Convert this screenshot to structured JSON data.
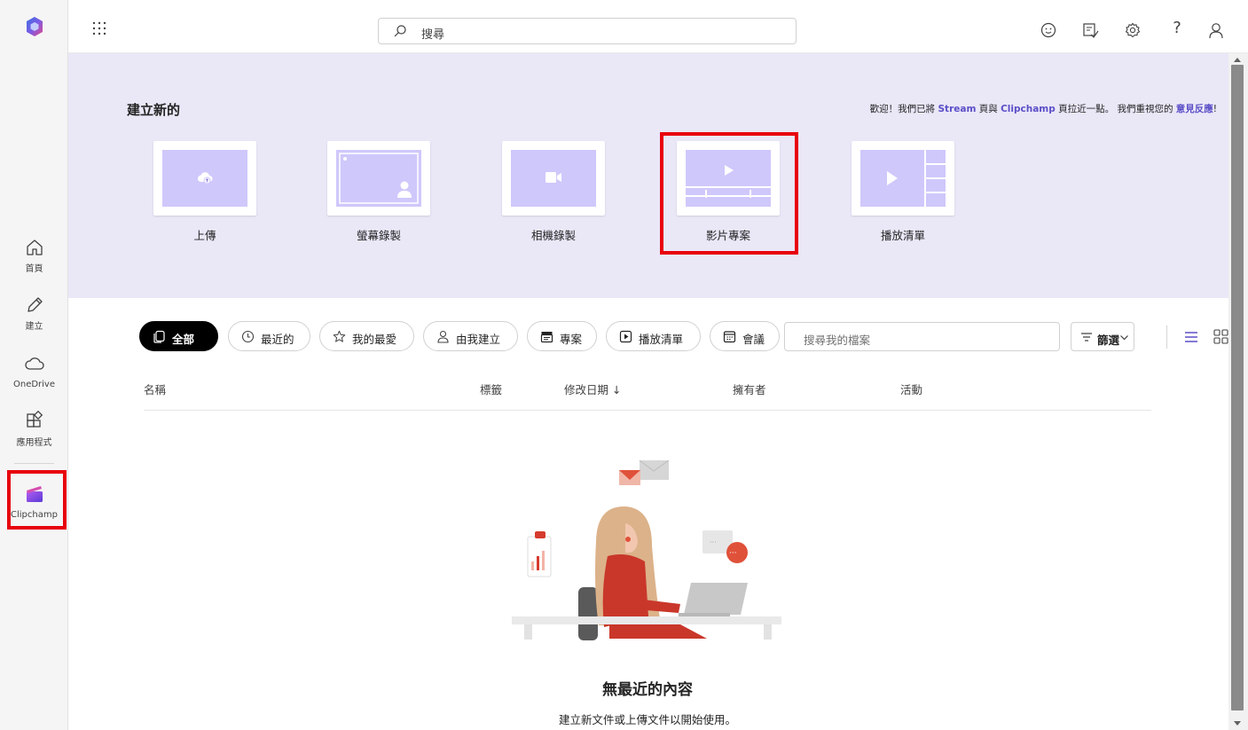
{
  "rail": {
    "items": [
      {
        "label": "首頁",
        "icon": "home-icon"
      },
      {
        "label": "建立",
        "icon": "pen-icon"
      },
      {
        "label": "OneDrive",
        "icon": "cloud-icon"
      },
      {
        "label": "應用程式",
        "icon": "apps-icon"
      },
      {
        "label": "Clipchamp",
        "icon": "clipchamp-icon"
      }
    ]
  },
  "topbar": {
    "search_placeholder": "搜尋",
    "icons": [
      "smiley-icon",
      "feedback-icon",
      "settings-icon",
      "help-icon",
      "account-icon"
    ],
    "help_glyph": "?"
  },
  "create": {
    "title": "建立新的",
    "message_pre": "歡迎！我們已將 ",
    "message_link1": "Stream",
    "message_mid1": " 頁與 ",
    "message_link2": "Clipchamp",
    "message_mid2": " 頁拉近一點。 我們重視您的 ",
    "message_link3": "意見反應",
    "message_end": "!",
    "tiles": [
      {
        "label": "上傳",
        "icon": "upload-cloud-icon"
      },
      {
        "label": "螢幕錄製",
        "icon": "screen-record-icon"
      },
      {
        "label": "相機錄製",
        "icon": "camera-icon"
      },
      {
        "label": "影片專案",
        "icon": "video-project-icon"
      },
      {
        "label": "播放清單",
        "icon": "playlist-icon"
      }
    ]
  },
  "filters": {
    "pills": [
      {
        "label": "全部",
        "icon": "all-icon",
        "active": true
      },
      {
        "label": "最近的",
        "icon": "clock-icon",
        "active": false
      },
      {
        "label": "我的最愛",
        "icon": "star-icon",
        "active": false
      },
      {
        "label": "由我建立",
        "icon": "person-icon",
        "active": false
      },
      {
        "label": "專案",
        "icon": "clapper-icon",
        "active": false
      },
      {
        "label": "播放清單",
        "icon": "play-square-icon",
        "active": false
      },
      {
        "label": "會議",
        "icon": "calendar-icon",
        "active": false
      }
    ],
    "search_placeholder": "搜尋我的檔案",
    "filter_label": "篩選"
  },
  "table": {
    "columns": [
      "名稱",
      "標籤",
      "修改日期 ↓",
      "擁有者",
      "活動"
    ]
  },
  "empty": {
    "title": "無最近的內容",
    "subtitle": "建立新文件或上傳文件以開始使用。"
  },
  "colors": {
    "accent": "#5b4fc7",
    "band_bg": "#eae7f7",
    "thumb": "#cfc8fb",
    "highlight": "#e8000b"
  }
}
